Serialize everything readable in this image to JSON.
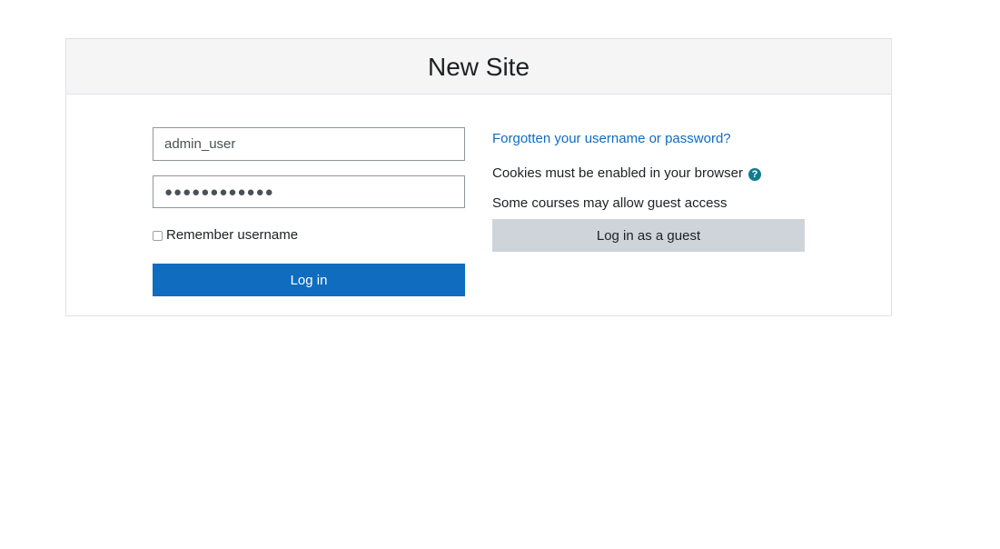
{
  "site": {
    "title": "New Site"
  },
  "login_form": {
    "username_value": "admin_user",
    "password_value": "●●●●●●●●●●●●",
    "remember_label": "Remember username",
    "remember_checked": false,
    "login_button_label": "Log in"
  },
  "help": {
    "forgot_link": "Forgotten your username or password?",
    "cookies_text": "Cookies must be enabled in your browser",
    "cookies_help_icon": "question-circle-icon",
    "guest_note": "Some courses may allow guest access",
    "guest_button_label": "Log in as a guest"
  },
  "colors": {
    "primary": "#0f6cbf",
    "help_icon": "#0f7d91",
    "secondary_button": "#ced4da",
    "header_bg": "#f5f5f5"
  }
}
